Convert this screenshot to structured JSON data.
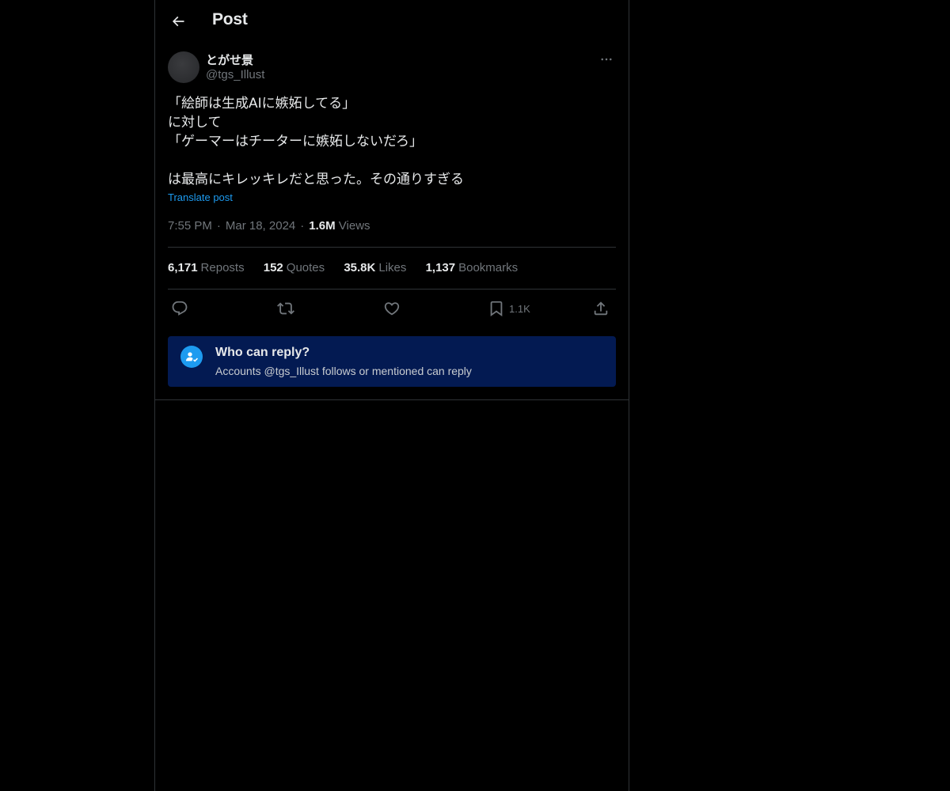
{
  "header": {
    "title": "Post",
    "back_icon": "arrow-left-icon"
  },
  "post": {
    "author": {
      "display_name": "とがせ景",
      "handle": "@tgs_Illust"
    },
    "text_lines": [
      "「絵師は生成AIに嫉妬してる」",
      "に対して",
      "「ゲーマーはチーターに嫉妬しないだろ」",
      "",
      "は最高にキレッキレだと思った。その通りすぎる"
    ],
    "translate_label": "Translate post",
    "time": "7:55 PM",
    "date": "Mar 18, 2024",
    "views_count": "1.6M",
    "views_label": "Views"
  },
  "stats": [
    {
      "count": "6,171",
      "label": "Reposts"
    },
    {
      "count": "152",
      "label": "Quotes"
    },
    {
      "count": "35.8K",
      "label": "Likes"
    },
    {
      "count": "1,137",
      "label": "Bookmarks"
    }
  ],
  "actions": {
    "reply_icon": "reply-icon",
    "repost_icon": "repost-icon",
    "like_icon": "heart-icon",
    "bookmark_icon": "bookmark-icon",
    "bookmark_count": "1.1K",
    "share_icon": "share-icon"
  },
  "who_can_reply": {
    "title": "Who can reply?",
    "subtitle": "Accounts @tgs_Illust follows or mentioned can reply",
    "icon": "person-mention-icon"
  },
  "colors": {
    "background": "#000000",
    "text_primary": "#e7e9ea",
    "text_secondary": "#71767b",
    "accent": "#1d9bf0",
    "border": "#2f3336",
    "reply_banner": "#031a52"
  }
}
